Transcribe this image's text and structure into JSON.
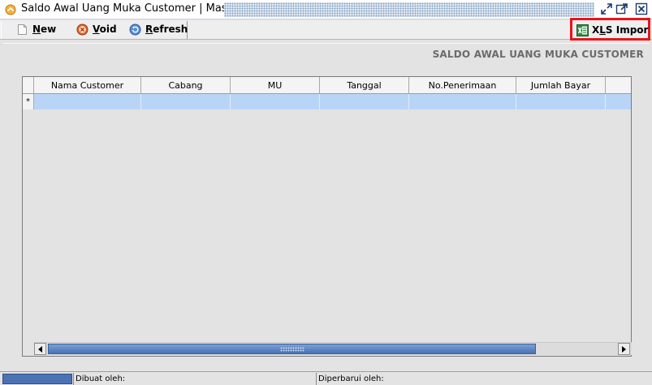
{
  "window": {
    "title": "Saldo Awal Uang Muka Customer | Master"
  },
  "toolbar": {
    "new_label_u": "N",
    "new_label_rest": "ew",
    "void_label_u": "V",
    "void_label_rest": "oid",
    "refresh_label_u": "R",
    "refresh_label_rest": "efresh",
    "xls_label_pre": "X",
    "xls_label_u": "L",
    "xls_label_rest": "S Impor"
  },
  "section": {
    "title": "SALDO AWAL UANG MUKA CUSTOMER"
  },
  "grid": {
    "columns": [
      "Nama Customer",
      "Cabang",
      "MU",
      "Tanggal",
      "No.Penerimaan",
      "Jumlah Bayar"
    ],
    "new_row_marker": "*"
  },
  "status": {
    "created_by": "Dibuat oleh:",
    "updated_by": "Diperbarui oleh:"
  },
  "colors": {
    "selected_row": "#b8d5f7",
    "highlight_border": "#e8141b",
    "accent": "#4a72b4"
  }
}
